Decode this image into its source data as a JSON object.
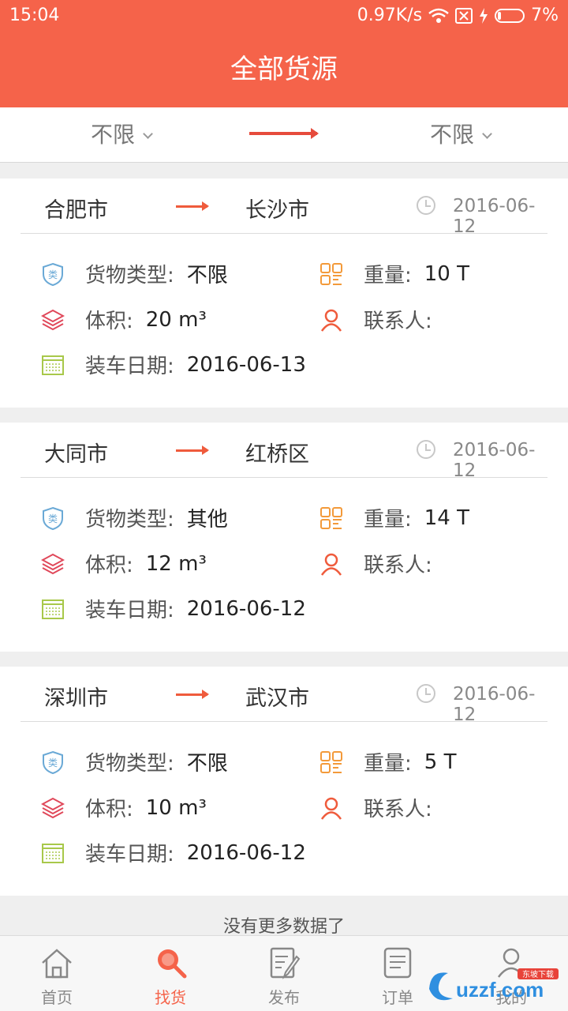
{
  "status_bar": {
    "time": "15:04",
    "speed": "0.97K/s",
    "battery": "7%"
  },
  "title": "全部货源",
  "filter": {
    "from": "不限",
    "to": "不限"
  },
  "labels": {
    "cargo_type": "货物类型:",
    "weight": "重量:",
    "volume": "体积:",
    "contact": "联系人:",
    "load_date": "装车日期:"
  },
  "cards": [
    {
      "from": "合肥市",
      "to": "长沙市",
      "date": "2016-06-12",
      "cargo_type": "不限",
      "weight": "10 T",
      "volume": "20 m³",
      "contact": "",
      "load_date": "2016-06-13"
    },
    {
      "from": "大同市",
      "to": "红桥区",
      "date": "2016-06-12",
      "cargo_type": "其他",
      "weight": "14 T",
      "volume": "12 m³",
      "contact": "",
      "load_date": "2016-06-12"
    },
    {
      "from": "深圳市",
      "to": "武汉市",
      "date": "2016-06-12",
      "cargo_type": "不限",
      "weight": "5 T",
      "volume": "10 m³",
      "contact": "",
      "load_date": "2016-06-12"
    }
  ],
  "no_more_text": "没有更多数据了",
  "tabs": [
    {
      "label": "首页",
      "icon": "home-icon"
    },
    {
      "label": "找货",
      "icon": "search-icon"
    },
    {
      "label": "发布",
      "icon": "edit-icon"
    },
    {
      "label": "订单",
      "icon": "order-icon"
    },
    {
      "label": "我的",
      "icon": "user-icon"
    }
  ],
  "watermark": "uzzf.com",
  "watermark_sub": "东坡下载",
  "colors": {
    "brand": "#f5634a",
    "arrow": "#ef5b3c",
    "type_icon": "#6aa9d6",
    "weight_icon": "#f39a3a",
    "volume_icon": "#e0485a",
    "contact_icon": "#ef5b3c",
    "date_icon": "#a8c84a"
  }
}
